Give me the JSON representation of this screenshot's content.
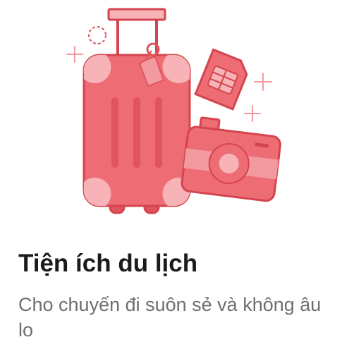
{
  "card": {
    "title": "Tiện ích du lịch",
    "description": "Cho chuyến đi suôn sẻ và không âu lo"
  },
  "illustration": {
    "icons": [
      "suitcase-icon",
      "luggage-tag-icon",
      "sim-card-icon",
      "camera-icon",
      "sparkle-icon"
    ],
    "colors": {
      "fill": "#ee6c74",
      "outline": "#d4444e",
      "light": "#f7b3b7",
      "shadow": "#e0545d"
    }
  }
}
